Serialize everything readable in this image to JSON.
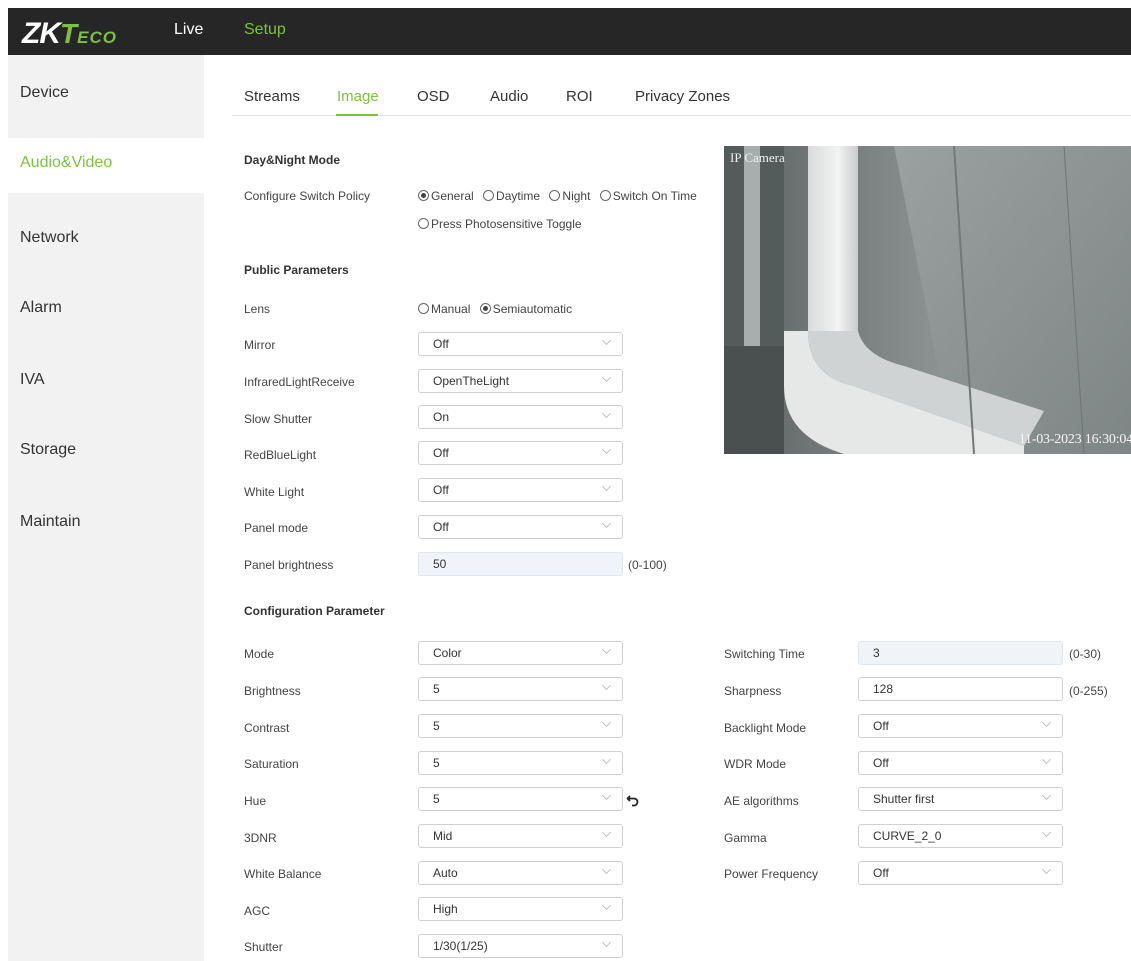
{
  "header": {
    "logo": {
      "zk": "ZK",
      "t": "T",
      "eco": "ECO"
    },
    "nav": {
      "live": "Live",
      "setup": "Setup"
    }
  },
  "sidebar": {
    "items": [
      {
        "label": "Device"
      },
      {
        "label": "Audio&Video",
        "active": true
      },
      {
        "label": "Network"
      },
      {
        "label": "Alarm"
      },
      {
        "label": "IVA"
      },
      {
        "label": "Storage"
      },
      {
        "label": "Maintain"
      }
    ]
  },
  "tabs": [
    {
      "label": "Streams"
    },
    {
      "label": "Image",
      "active": true
    },
    {
      "label": "OSD"
    },
    {
      "label": "Audio"
    },
    {
      "label": "ROI"
    },
    {
      "label": "Privacy Zones"
    }
  ],
  "daynight": {
    "title": "Day&Night Mode",
    "policy_label": "Configure Switch Policy",
    "options": [
      "General",
      "Daytime",
      "Night",
      "Switch On Time",
      "Press Photosensitive Toggle"
    ],
    "selected": "General"
  },
  "public": {
    "title": "Public Parameters",
    "lens_label": "Lens",
    "lens_options": [
      "Manual",
      "Semiautomatic"
    ],
    "lens_selected": "Semiautomatic",
    "mirror_label": "Mirror",
    "mirror_value": "Off",
    "infrared_label": "InfraredLightReceive",
    "infrared_value": "OpenTheLight",
    "slow_shutter_label": "Slow Shutter",
    "slow_shutter_value": "On",
    "redblue_label": "RedBlueLight",
    "redblue_value": "Off",
    "white_light_label": "White Light",
    "white_light_value": "Off",
    "panel_mode_label": "Panel mode",
    "panel_mode_value": "Off",
    "panel_brightness_label": "Panel brightness",
    "panel_brightness_value": "50",
    "panel_brightness_range": "(0-100)"
  },
  "config": {
    "title": "Configuration Parameter",
    "mode_label": "Mode",
    "mode_value": "Color",
    "brightness_label": "Brightness",
    "brightness_value": "5",
    "contrast_label": "Contrast",
    "contrast_value": "5",
    "saturation_label": "Saturation",
    "saturation_value": "5",
    "hue_label": "Hue",
    "hue_value": "5",
    "dnr_label": "3DNR",
    "dnr_value": "Mid",
    "wb_label": "White Balance",
    "wb_value": "Auto",
    "agc_label": "AGC",
    "agc_value": "High",
    "shutter_label": "Shutter",
    "shutter_value": "1/30(1/25)",
    "switching_time_label": "Switching Time",
    "switching_time_value": "3",
    "switching_time_range": "(0-30)",
    "sharpness_label": "Sharpness",
    "sharpness_value": "128",
    "sharpness_range": "(0-255)",
    "backlight_label": "Backlight Mode",
    "backlight_value": "Off",
    "wdr_label": "WDR Mode",
    "wdr_value": "Off",
    "ae_label": "AE algorithms",
    "ae_value": "Shutter first",
    "gamma_label": "Gamma",
    "gamma_value": "CURVE_2_0",
    "power_freq_label": "Power Frequency",
    "power_freq_value": "Off"
  },
  "preview": {
    "osd_title": "IP Camera",
    "timestamp": "11-03-2023 16:30:04"
  },
  "colors": {
    "accent": "#7cc242",
    "topbar": "#262626",
    "sidebar": "#f2f2f2"
  }
}
